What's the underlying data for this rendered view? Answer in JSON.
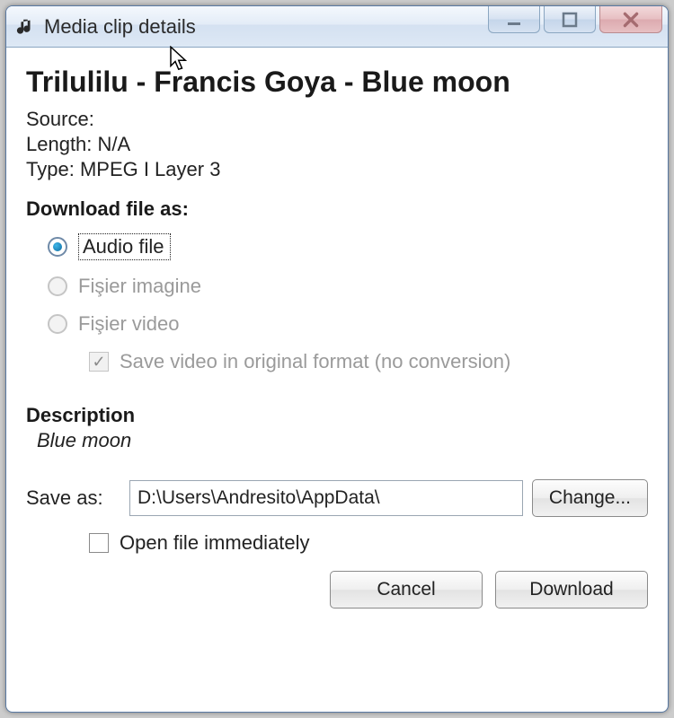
{
  "window": {
    "title": "Media clip details"
  },
  "media": {
    "title": "Trilulilu - Francis Goya - Blue moon",
    "source_label": "Source:",
    "source_value": "",
    "length_label": "Length:",
    "length_value": "N/A",
    "type_label": "Type:",
    "type_value": "MPEG I Layer 3"
  },
  "download": {
    "section_label": "Download file as:",
    "options": {
      "audio": "Audio file",
      "image": "Fişier imagine",
      "video": "Fişier video"
    },
    "save_original_label": "Save video in original format (no conversion)"
  },
  "description": {
    "label": "Description",
    "text": "Blue moon"
  },
  "save": {
    "label": "Save as:",
    "path": "D:\\Users\\Andresito\\AppData\\",
    "change_label": "Change..."
  },
  "open_immediately_label": "Open file immediately",
  "buttons": {
    "cancel": "Cancel",
    "download": "Download"
  }
}
